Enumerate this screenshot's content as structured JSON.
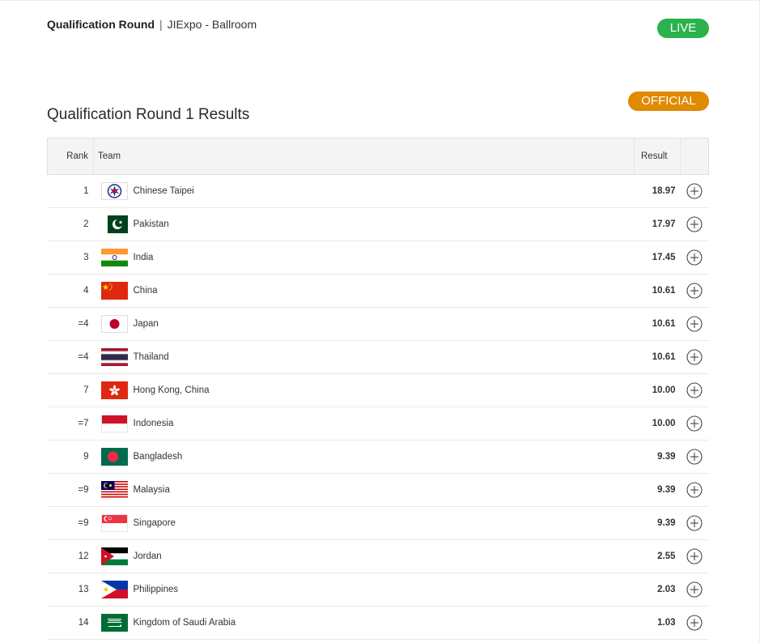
{
  "header": {
    "event": "Qualification Round",
    "separator": "|",
    "venue": "JIExpo - Ballroom"
  },
  "badges": {
    "live": "LIVE",
    "official": "OFFICIAL",
    "live_color": "#2bb24c",
    "official_color": "#e08a00"
  },
  "section_title": "Qualification Round 1 Results",
  "table": {
    "columns": {
      "rank": "Rank",
      "team": "Team",
      "result": "Result"
    },
    "rows": [
      {
        "rank": "1",
        "team": "Chinese Taipei",
        "result": "18.97",
        "flag": "chinese-taipei-flag"
      },
      {
        "rank": "2",
        "team": "Pakistan",
        "result": "17.97",
        "flag": "pakistan-flag"
      },
      {
        "rank": "3",
        "team": "India",
        "result": "17.45",
        "flag": "india-flag"
      },
      {
        "rank": "4",
        "team": "China",
        "result": "10.61",
        "flag": "china-flag"
      },
      {
        "rank": "=4",
        "team": "Japan",
        "result": "10.61",
        "flag": "japan-flag"
      },
      {
        "rank": "=4",
        "team": "Thailand",
        "result": "10.61",
        "flag": "thailand-flag"
      },
      {
        "rank": "7",
        "team": "Hong Kong, China",
        "result": "10.00",
        "flag": "hong-kong-flag"
      },
      {
        "rank": "=7",
        "team": "Indonesia",
        "result": "10.00",
        "flag": "indonesia-flag"
      },
      {
        "rank": "9",
        "team": "Bangladesh",
        "result": "9.39",
        "flag": "bangladesh-flag"
      },
      {
        "rank": "=9",
        "team": "Malaysia",
        "result": "9.39",
        "flag": "malaysia-flag"
      },
      {
        "rank": "=9",
        "team": "Singapore",
        "result": "9.39",
        "flag": "singapore-flag"
      },
      {
        "rank": "12",
        "team": "Jordan",
        "result": "2.55",
        "flag": "jordan-flag"
      },
      {
        "rank": "13",
        "team": "Philippines",
        "result": "2.03",
        "flag": "philippines-flag"
      },
      {
        "rank": "14",
        "team": "Kingdom of Saudi Arabia",
        "result": "1.03",
        "flag": "saudi-arabia-flag"
      }
    ],
    "row_action_icon": "plus-circle-icon"
  }
}
